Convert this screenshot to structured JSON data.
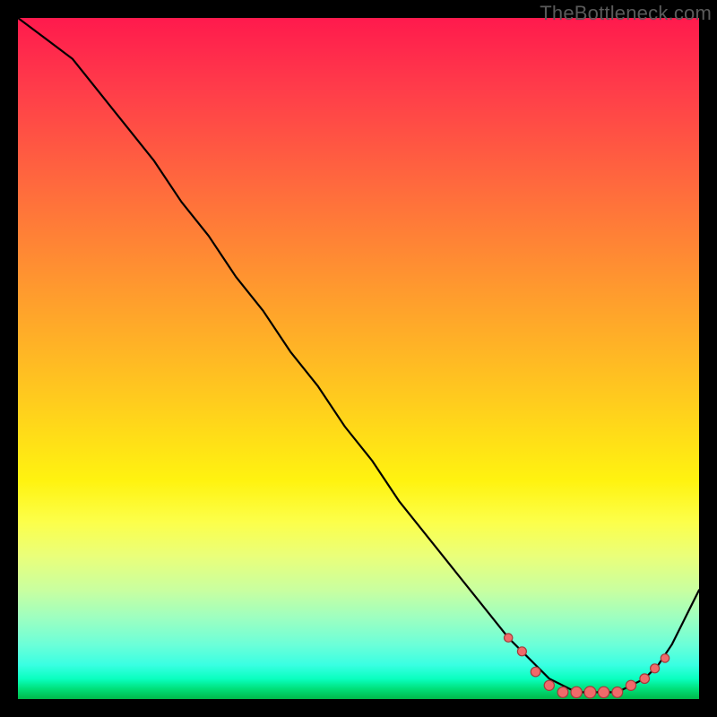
{
  "watermark": {
    "text": "TheBottleneck.com"
  },
  "chart_data": {
    "type": "line",
    "title": "",
    "xlabel": "",
    "ylabel": "",
    "xlim": [
      0,
      100
    ],
    "ylim": [
      0,
      100
    ],
    "grid": false,
    "legend": false,
    "background": "red-yellow-green vertical gradient",
    "series": [
      {
        "name": "bottleneck-curve",
        "x": [
          0,
          4,
          8,
          12,
          16,
          20,
          24,
          28,
          32,
          36,
          40,
          44,
          48,
          52,
          56,
          60,
          64,
          68,
          72,
          74,
          76,
          78,
          80,
          82,
          84,
          86,
          88,
          90,
          92,
          94,
          96,
          98,
          100
        ],
        "y": [
          100,
          97,
          94,
          89,
          84,
          79,
          73,
          68,
          62,
          57,
          51,
          46,
          40,
          35,
          29,
          24,
          19,
          14,
          9,
          7,
          5,
          3,
          2,
          1,
          1,
          1,
          1,
          2,
          3,
          5,
          8,
          12,
          16
        ]
      }
    ],
    "markers": {
      "name": "highlight-dots",
      "color": "#f06a6a",
      "points_x": [
        72,
        74,
        76,
        78,
        80,
        82,
        84,
        86,
        88,
        90,
        92,
        93.5,
        95
      ],
      "points_y": [
        9,
        7,
        4,
        2,
        1,
        1,
        1,
        1,
        1,
        2,
        3,
        4.5,
        6
      ]
    }
  }
}
